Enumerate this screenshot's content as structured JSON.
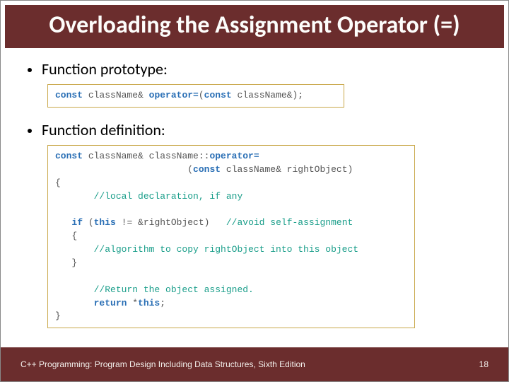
{
  "title": "Overloading the Assignment Operator (=)",
  "bullets": {
    "prototype": "Function prototype:",
    "definition": "Function definition:"
  },
  "code": {
    "prototype": {
      "kw_const": "const",
      "t1": " className& ",
      "op_eq": "operator=",
      "t2": "(",
      "kw_const2": "const",
      "t3": " className&);"
    },
    "definition": {
      "l1_kw": "const",
      "l1_a": " className& className::",
      "l1_op": "operator=",
      "l2_a": "                        (",
      "l2_kw": "const",
      "l2_b": " className& rightObject)",
      "l3": "{",
      "l4_pad": "       ",
      "l4_c": "//local declaration, if any",
      "l5": "",
      "l6_pad": "   ",
      "l6_kw": "if",
      "l6_a": " (",
      "l6_kw2": "this",
      "l6_b": " != &rightObject)   ",
      "l6_c": "//avoid self-assignment",
      "l7": "   {",
      "l8_pad": "       ",
      "l8_c": "//algorithm to copy rightObject into this object",
      "l9": "   }",
      "l10": "",
      "l11_pad": "       ",
      "l11_c": "//Return the object assigned.",
      "l12_pad": "       ",
      "l12_kw": "return",
      "l12_a": " *",
      "l12_kw2": "this",
      "l12_b": ";",
      "l13": "}"
    }
  },
  "footer": {
    "source": "C++ Programming: Program Design Including Data Structures, Sixth Edition",
    "page": "18"
  }
}
